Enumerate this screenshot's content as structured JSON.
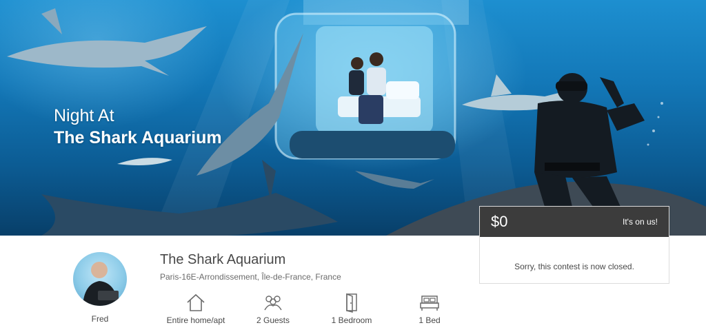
{
  "hero": {
    "title_line1": "Night At",
    "title_line2": "The Shark Aquarium"
  },
  "price": {
    "amount": "$0",
    "note": "It's on us!",
    "message": "Sorry, this contest is now closed."
  },
  "host": {
    "name": "Fred"
  },
  "listing": {
    "title": "The Shark Aquarium",
    "location": "Paris-16E-Arrondissement, Île-de-France, France",
    "amenities": [
      {
        "icon": "home-icon",
        "label": "Entire home/apt"
      },
      {
        "icon": "guests-icon",
        "label": "2 Guests"
      },
      {
        "icon": "door-icon",
        "label": "1 Bedroom"
      },
      {
        "icon": "bed-icon",
        "label": "1 Bed"
      }
    ]
  }
}
